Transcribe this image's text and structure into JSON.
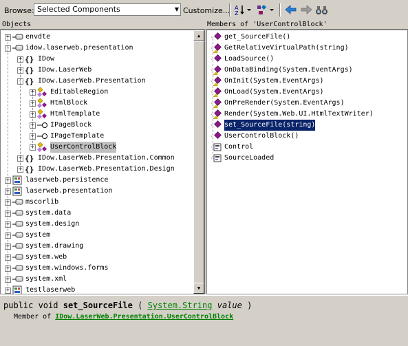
{
  "toolbar": {
    "browse_label": "Browse:",
    "browse_value": "Selected Components",
    "customize_label": "Customize..."
  },
  "objects_header": "Objects",
  "members_header": "Members of 'UserControlBlock'",
  "objects": [
    {
      "label": "envdte",
      "icon": "assembly-icon",
      "expander": "+"
    },
    {
      "label": "idow.laserweb.presentation",
      "icon": "assembly-icon",
      "expander": "-"
    },
    {
      "label": "IDow",
      "icon": "namespace-icon",
      "expander": "+"
    },
    {
      "label": "IDow.LaserWeb",
      "icon": "namespace-icon",
      "expander": "+"
    },
    {
      "label": "IDow.LaserWeb.Presentation",
      "icon": "namespace-icon",
      "expander": "-"
    },
    {
      "label": "EditableRegion",
      "icon": "class-icon",
      "expander": "+"
    },
    {
      "label": "HtmlBlock",
      "icon": "class-icon",
      "expander": "+"
    },
    {
      "label": "HtmlTemplate",
      "icon": "class-icon",
      "expander": "+"
    },
    {
      "label": "IPageBlock",
      "icon": "interface-icon",
      "expander": "+"
    },
    {
      "label": "IPageTemplate",
      "icon": "interface-icon",
      "expander": "+"
    },
    {
      "label": "UserControlBlock",
      "icon": "class-icon",
      "expander": "+"
    },
    {
      "label": "IDow.LaserWeb.Presentation.Common",
      "icon": "namespace-icon",
      "expander": "+"
    },
    {
      "label": "IDow.LaserWeb.Presentation.Design",
      "icon": "namespace-icon",
      "expander": "+"
    },
    {
      "label": "laserweb.persistence",
      "icon": "project-icon",
      "expander": "+"
    },
    {
      "label": "laserweb.presentation",
      "icon": "project-icon",
      "expander": "+"
    },
    {
      "label": "mscorlib",
      "icon": "assembly-icon",
      "expander": "+"
    },
    {
      "label": "system.data",
      "icon": "assembly-icon",
      "expander": "+"
    },
    {
      "label": "system.design",
      "icon": "assembly-icon",
      "expander": "+"
    },
    {
      "label": "system",
      "icon": "assembly-icon",
      "expander": "+"
    },
    {
      "label": "system.drawing",
      "icon": "assembly-icon",
      "expander": "+"
    },
    {
      "label": "system.web",
      "icon": "assembly-icon",
      "expander": "+"
    },
    {
      "label": "system.windows.forms",
      "icon": "assembly-icon",
      "expander": "+"
    },
    {
      "label": "system.xml",
      "icon": "assembly-icon",
      "expander": "+"
    },
    {
      "label": "testlaserweb",
      "icon": "project-icon",
      "expander": "+"
    }
  ],
  "members": [
    {
      "label": "get_SourceFile()",
      "icon": "method-icon"
    },
    {
      "label": "GetRelativeVirtualPath(string)",
      "icon": "protected-method-icon"
    },
    {
      "label": "LoadSource()",
      "icon": "method-icon"
    },
    {
      "label": "OnDataBinding(System.EventArgs)",
      "icon": "protected-method-icon"
    },
    {
      "label": "OnInit(System.EventArgs)",
      "icon": "protected-method-icon"
    },
    {
      "label": "OnLoad(System.EventArgs)",
      "icon": "protected-method-icon"
    },
    {
      "label": "OnPreRender(System.EventArgs)",
      "icon": "protected-method-icon"
    },
    {
      "label": "Render(System.Web.UI.HtmlTextWriter)",
      "icon": "protected-method-icon"
    },
    {
      "label": "set_SourceFile(string)",
      "icon": "method-icon"
    },
    {
      "label": "UserControlBlock()",
      "icon": "method-icon"
    },
    {
      "label": "Control",
      "icon": "base-type-icon"
    },
    {
      "label": "SourceLoaded",
      "icon": "base-type-icon"
    }
  ],
  "description": {
    "prefix": "public void",
    "method_name": "set_SourceFile",
    "open_paren": "(",
    "param_type": "System.String",
    "param_name": "value",
    "close_paren": ")",
    "member_of_label": "Member of",
    "member_of_link": "IDow.LaserWeb.Presentation.UserControlBlock"
  }
}
